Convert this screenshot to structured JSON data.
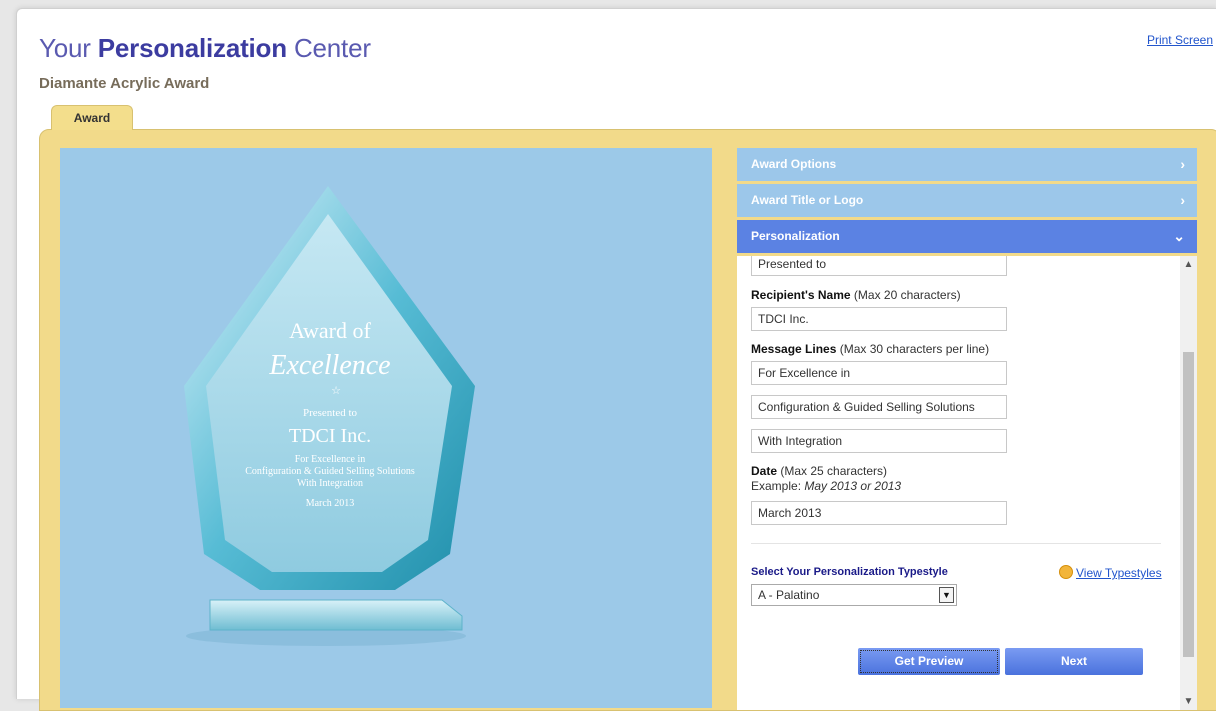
{
  "header": {
    "title_pre": "Your ",
    "title_strong": "Personalization",
    "title_post": " Center",
    "subtitle": "Diamante Acrylic Award",
    "print_link": "Print Screen"
  },
  "tabs": [
    {
      "label": "Award"
    }
  ],
  "preview": {
    "award_of": "Award of",
    "excellence": "Excellence",
    "star": "☆",
    "presented": "Presented to",
    "recipient": "TDCI Inc.",
    "line1": "For Excellence in",
    "line2": "Configuration & Guided Selling Solutions",
    "line3": "With Integration",
    "date": "March 2013"
  },
  "accordion": {
    "sections": [
      {
        "label": "Award Options",
        "icon": "chevron-right-icon"
      },
      {
        "label": "Award Title or Logo",
        "icon": "chevron-right-icon"
      },
      {
        "label": "Personalization",
        "icon": "chevron-down-icon"
      }
    ]
  },
  "form": {
    "presented_value": "Presented to",
    "recipient_label_bold": "Recipient's Name",
    "recipient_label_rest": " (Max 20 characters)",
    "recipient_value": "TDCI Inc.",
    "message_label_bold": "Message Lines",
    "message_label_rest": " (Max 30 characters per line)",
    "message_values": [
      "For Excellence in",
      "Configuration & Guided Selling Solutions",
      "With Integration"
    ],
    "date_label_bold": "Date",
    "date_label_rest": " (Max 25 characters)",
    "example_label": "Example: ",
    "example_value": "May 2013 or 2013",
    "date_value": "March 2013",
    "typestyle_label": "Select Your Personalization Typestyle",
    "view_typestyles": "View Typestyles",
    "typestyle_selected": "A - Palatino",
    "preview_button": "Get Preview",
    "next_button": "Next"
  },
  "colors": {
    "title": "#5a5ab0",
    "panel": "#f2da8a",
    "image_bg": "#9cc9e8",
    "accordion_inactive": "#9cc7ea",
    "accordion_active": "#5b82e3"
  }
}
